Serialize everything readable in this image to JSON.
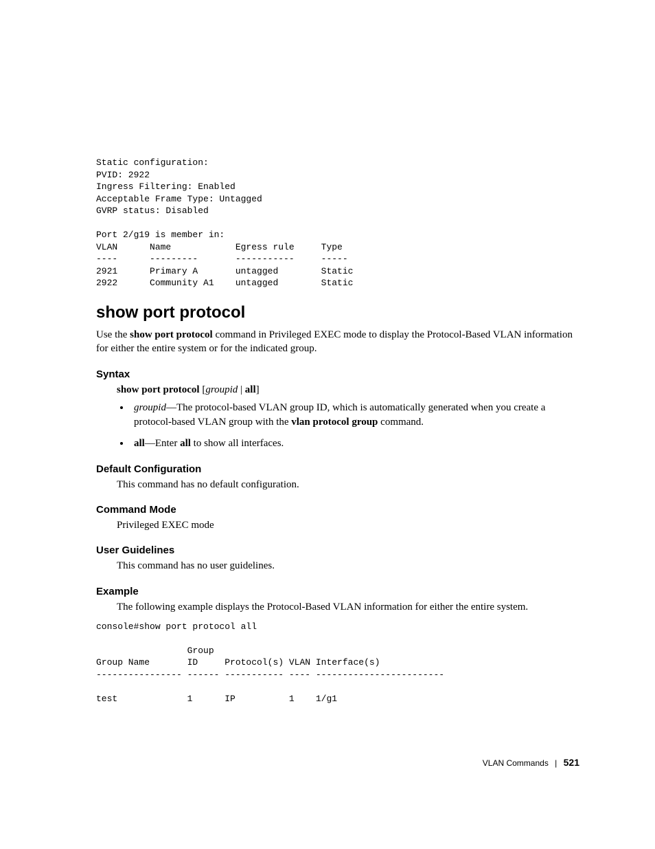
{
  "pre1": "Static configuration:\nPVID: 2922\nIngress Filtering: Enabled\nAcceptable Frame Type: Untagged\nGVRP status: Disabled\n\nPort 2/g19 is member in:\nVLAN      Name            Egress rule     Type\n----      ---------       -----------     -----\n2921      Primary A       untagged        Static\n2922      Community A1    untagged        Static",
  "title": "show port protocol",
  "intro_pre": "Use the ",
  "intro_bold": "show port protocol",
  "intro_post": " command in Privileged EXEC mode to display the Protocol-Based VLAN information for either the entire system or for the indicated group.",
  "syntax": {
    "head": "Syntax",
    "cmd_bold": "show port protocol",
    "cmd_bracket_open": " [",
    "cmd_italic": "groupid",
    "cmd_mid": " | ",
    "cmd_all": "all",
    "cmd_bracket_close": "]",
    "item1_it": "groupid",
    "item1_dash": "—The protocol-based VLAN group ID, which is automatically generated when you create a protocol-based VLAN group with the ",
    "item1_bold": "vlan protocol group",
    "item1_end": " command.",
    "item2_bold1": "all",
    "item2_mid": "—Enter ",
    "item2_bold2": "all",
    "item2_end": " to show all interfaces."
  },
  "default_cfg": {
    "head": "Default Configuration",
    "text": "This command has no default configuration."
  },
  "command_mode": {
    "head": "Command Mode",
    "text": "Privileged EXEC mode"
  },
  "user_guidelines": {
    "head": "User Guidelines",
    "text": "This command has no user guidelines."
  },
  "example": {
    "head": "Example",
    "text": "The following example displays the Protocol-Based VLAN information for either the entire system."
  },
  "pre2": "console#show port protocol all\n\n                 Group\nGroup Name       ID     Protocol(s) VLAN Interface(s)\n---------------- ------ ----------- ---- ------------------------\n\ntest             1      IP          1    1/g1",
  "footer": {
    "label": "VLAN Commands",
    "page": "521"
  }
}
